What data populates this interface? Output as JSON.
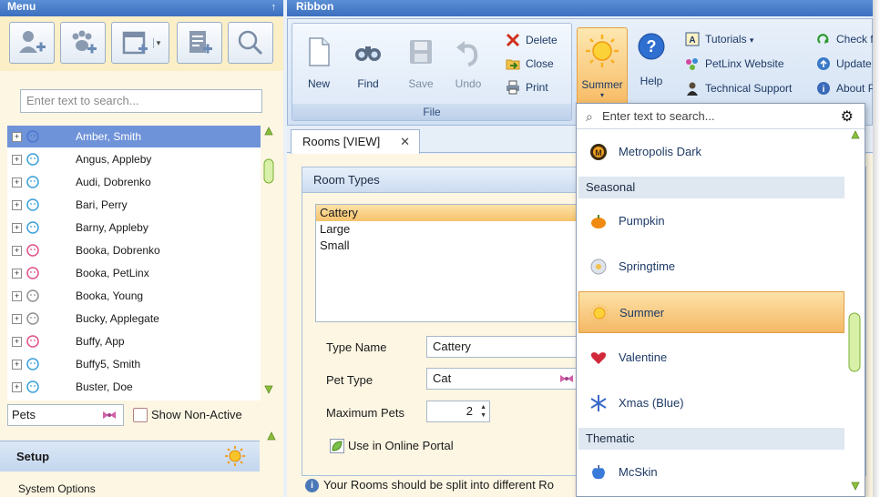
{
  "menu": {
    "title": "Menu",
    "search_placeholder": "Enter text to search...",
    "pets": [
      {
        "name": "Amber, Smith",
        "color": "#4a78d0",
        "selected": true
      },
      {
        "name": "Angus, Appleby",
        "color": "#3aa0d8",
        "selected": false
      },
      {
        "name": "Audi, Dobrenko",
        "color": "#3aa0d8",
        "selected": false
      },
      {
        "name": "Bari, Perry",
        "color": "#3aa0d8",
        "selected": false
      },
      {
        "name": "Barny, Appleby",
        "color": "#3aa0d8",
        "selected": false
      },
      {
        "name": "Booka, Dobrenko",
        "color": "#e0508a",
        "selected": false
      },
      {
        "name": "Booka, PetLinx",
        "color": "#e0508a",
        "selected": false
      },
      {
        "name": "Booka, Young",
        "color": "#909090",
        "selected": false
      },
      {
        "name": "Bucky, Applegate",
        "color": "#909090",
        "selected": false
      },
      {
        "name": "Buffy, App",
        "color": "#e0508a",
        "selected": false
      },
      {
        "name": "Buffy5, Smith",
        "color": "#3aa0d8",
        "selected": false
      },
      {
        "name": "Buster, Doe",
        "color": "#3aa0d8",
        "selected": false
      }
    ],
    "filter_value": "Pets",
    "show_non_active_label": "Show Non-Active",
    "setup_label": "Setup",
    "system_options_label": "System Options"
  },
  "ribbon": {
    "title": "Ribbon",
    "file_group_label": "File",
    "new_label": "New",
    "find_label": "Find",
    "save_label": "Save",
    "undo_label": "Undo",
    "delete_label": "Delete",
    "close_label": "Close",
    "print_label": "Print",
    "summer_label": "Summer",
    "help_label": "Help",
    "tutorials_label": "Tutorials",
    "petlinx_website_label": "PetLinx Website",
    "technical_support_label": "Technical Support",
    "check_label": "Check f",
    "update_label": "Update",
    "about_label": "About P"
  },
  "document": {
    "tab_label": "Rooms [VIEW]",
    "panel_title": "Room Types",
    "room_types": [
      "Cattery",
      "Large",
      "Small"
    ],
    "type_name_label": "Type Name",
    "type_name_value": "Cattery",
    "pet_type_label": "Pet Type",
    "pet_type_value": "Cat",
    "max_pets_label": "Maximum Pets",
    "max_pets_value": "2",
    "online_portal_label": "Use in Online Portal",
    "info_text": "Your Rooms should be split into different Ro"
  },
  "skin_dropdown": {
    "search_placeholder": "Enter text to search...",
    "items": [
      {
        "kind": "item",
        "label": "Metropolis Dark",
        "icon": "metropolis-dark-icon"
      },
      {
        "kind": "group",
        "label": "Seasonal"
      },
      {
        "kind": "item",
        "label": "Pumpkin",
        "icon": "pumpkin-icon"
      },
      {
        "kind": "item",
        "label": "Springtime",
        "icon": "springtime-icon"
      },
      {
        "kind": "item",
        "label": "Summer",
        "icon": "summer-icon",
        "selected": true
      },
      {
        "kind": "item",
        "label": "Valentine",
        "icon": "heart-icon"
      },
      {
        "kind": "item",
        "label": "Xmas (Blue)",
        "icon": "snowflake-icon"
      },
      {
        "kind": "group",
        "label": "Thematic"
      },
      {
        "kind": "item",
        "label": "McSkin",
        "icon": "apple-icon"
      }
    ]
  }
}
